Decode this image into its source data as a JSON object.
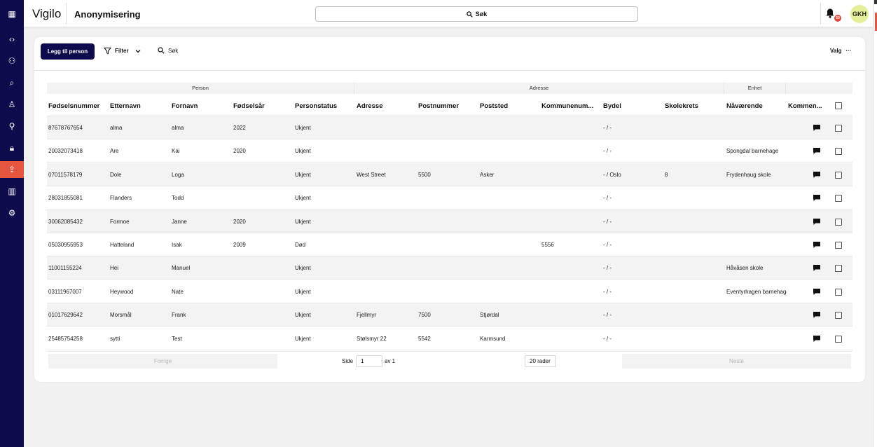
{
  "app": {
    "name": "Vigilo",
    "page_title": "Anonymisering"
  },
  "search": {
    "label": "Søk"
  },
  "notifications": {
    "count": "50"
  },
  "user": {
    "initials": "GKH"
  },
  "nav": [
    {
      "icon": "apps-grid-icon",
      "glyph": "▦"
    },
    {
      "icon": "code-icon",
      "glyph": "‹›"
    },
    {
      "icon": "people-network-icon",
      "glyph": "⚇"
    },
    {
      "icon": "person-search-icon",
      "glyph": "⌕"
    },
    {
      "icon": "person-icon",
      "glyph": "♙"
    },
    {
      "icon": "person-key-icon",
      "glyph": "⚲"
    },
    {
      "icon": "lock-icon",
      "glyph": "🔒︎"
    },
    {
      "icon": "anonymize-icon",
      "glyph": "⇪",
      "active": true
    },
    {
      "icon": "chart-icon",
      "glyph": "▥"
    },
    {
      "icon": "settings-icon",
      "glyph": "⚙"
    }
  ],
  "toolbar": {
    "add_person": "Legg til person",
    "filter": "Filter",
    "search": "Søk",
    "options": "Valg",
    "options_dots": "···"
  },
  "table": {
    "groups": [
      "Person",
      "Adresse",
      "Enhet"
    ],
    "columns": [
      "Fødselsnummer",
      "Etternavn",
      "Fornavn",
      "Fødselsår",
      "Personstatus",
      "Adresse",
      "Postnummer",
      "Poststed",
      "Kommunenum...",
      "Bydel",
      "Skolekrets",
      "Nåværende",
      "Kommen..."
    ],
    "rows": [
      [
        "87678767654",
        "alma",
        "alma",
        "2022",
        "Ukjent",
        "",
        "",
        "",
        "",
        "- / -",
        "",
        ""
      ],
      [
        "20032073418",
        "Are",
        "Kai",
        "2020",
        "Ukjent",
        "",
        "",
        "",
        "",
        "- / -",
        "",
        "Spongdal barnehage"
      ],
      [
        "07011578179",
        "Dole",
        "Loga",
        "",
        "Ukjent",
        "West Street",
        "5500",
        "Asker",
        "",
        "- / Oslo",
        "8",
        "Frydenhaug skole"
      ],
      [
        "28031855081",
        "Flanders",
        "Todd",
        "",
        "Ukjent",
        "",
        "",
        "",
        "",
        "- / -",
        "",
        ""
      ],
      [
        "30062085432",
        "Formoe",
        "Janne",
        "2020",
        "Ukjent",
        "",
        "",
        "",
        "",
        "- / -",
        "",
        ""
      ],
      [
        "05030955953",
        "Hatteland",
        "Isak",
        "2009",
        "Død",
        "",
        "",
        "",
        "5556",
        "- / -",
        "",
        ""
      ],
      [
        "11001155224",
        "Hei",
        "Manuel",
        "",
        "Ukjent",
        "",
        "",
        "",
        "",
        "- / -",
        "",
        "Håvåsen skole"
      ],
      [
        "03111967007",
        "Heywood",
        "Nate",
        "",
        "Ukjent",
        "",
        "",
        "",
        "",
        "- / -",
        "",
        "Eventyrhagen barnehage"
      ],
      [
        "01017629642",
        "Morsmål",
        "Frank",
        "",
        "Ukjent",
        "Fjellmyr",
        "7500",
        "Stjørdal",
        "",
        "- / -",
        "",
        ""
      ],
      [
        "25485754258",
        "sytti",
        "Test",
        "",
        "Ukjent",
        "Stølsmyr 22",
        "5542",
        "Karmsund",
        "",
        "- / -",
        "",
        ""
      ]
    ]
  },
  "pagination": {
    "prev": "Forrige",
    "next": "Neste",
    "page_label": "Side",
    "page_value": "1",
    "of_label": "av 1",
    "rows_per_page": "20 rader"
  }
}
